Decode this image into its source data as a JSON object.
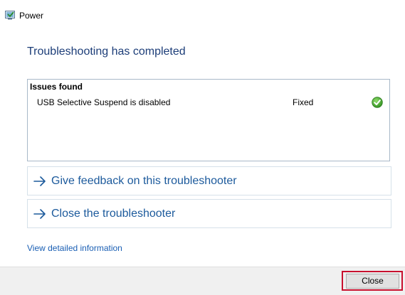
{
  "window": {
    "title": "Power",
    "icon": "troubleshooter-icon"
  },
  "heading": "Troubleshooting has completed",
  "issues": {
    "header": "Issues found",
    "rows": [
      {
        "name": "USB Selective Suspend is disabled",
        "status": "Fixed",
        "status_icon": "check-icon",
        "status_color": "#3c9a2b"
      }
    ]
  },
  "links": {
    "feedback": "Give feedback on this troubleshooter",
    "close_troubleshooter": "Close the troubleshooter",
    "arrow_icon": "arrow-right-icon",
    "view_details": "View detailed information"
  },
  "footer": {
    "close_label": "Close"
  },
  "colors": {
    "heading": "#1c3d78",
    "link": "#1c5a9c",
    "highlight": "#c8102e"
  }
}
